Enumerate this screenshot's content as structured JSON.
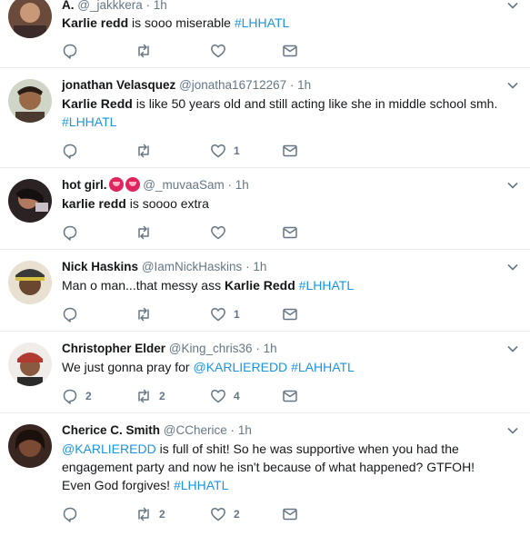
{
  "tweets": [
    {
      "name": "A.",
      "handle": "@_jakkkera",
      "dot": "·",
      "time": "1h",
      "text": [
        {
          "t": "Karlie redd",
          "s": "bold"
        },
        {
          "t": " is sooo miserable ",
          "s": ""
        },
        {
          "t": "#LHHATL",
          "s": "link"
        }
      ],
      "counts": {
        "reply": "",
        "retweet": "",
        "like": ""
      },
      "avatar_color": "#6a4a3a"
    },
    {
      "name": "jonathan Velasquez",
      "handle": "@jonatha16712267",
      "dot": "·",
      "time": "1h",
      "text": [
        {
          "t": "Karlie Redd",
          "s": "bold"
        },
        {
          "t": " is like 50 years old and still acting like she in middle school smh. ",
          "s": ""
        },
        {
          "t": "#LHHATL",
          "s": "link"
        }
      ],
      "counts": {
        "reply": "",
        "retweet": "",
        "like": "1"
      },
      "avatar_color": "#7a5a3e"
    },
    {
      "name": "hot girl.",
      "handle": "@_muvaaSam",
      "dot": "·",
      "time": "1h",
      "text": [
        {
          "t": "karlie redd",
          "s": "bold"
        },
        {
          "t": " is soooo extra",
          "s": ""
        }
      ],
      "counts": {
        "reply": "",
        "retweet": "",
        "like": ""
      },
      "avatar_color": "#2b2224"
    },
    {
      "name": "Nick Haskins",
      "handle": "@IamNickHaskins",
      "dot": "·",
      "time": "1h",
      "text": [
        {
          "t": "Man o man...that messy ass ",
          "s": ""
        },
        {
          "t": "Karlie Redd",
          "s": "bold"
        },
        {
          "t": " ",
          "s": ""
        },
        {
          "t": "#LHHATL",
          "s": "link"
        }
      ],
      "counts": {
        "reply": "",
        "retweet": "",
        "like": "1"
      },
      "avatar_color": "#8a6a4a"
    },
    {
      "name": "Christopher Elder",
      "handle": "@King_chris36",
      "dot": "·",
      "time": "1h",
      "text": [
        {
          "t": "We just gonna pray for ",
          "s": ""
        },
        {
          "t": "@KARLIEREDD",
          "s": "link"
        },
        {
          "t": " ",
          "s": ""
        },
        {
          "t": "#LAHHATL",
          "s": "link"
        }
      ],
      "counts": {
        "reply": "2",
        "retweet": "2",
        "like": "4"
      },
      "avatar_color": "#a04a3a"
    },
    {
      "name": "Cherice C. Smith",
      "handle": "@CCherice",
      "dot": "·",
      "time": "1h",
      "text": [
        {
          "t": "@KARLIEREDD",
          "s": "link"
        },
        {
          "t": " is full of shit! So he was supportive when you had the engagement party and now he isn't because of what happened? GTFOH! Even God forgives!  ",
          "s": ""
        },
        {
          "t": "#LHHATL",
          "s": "link"
        }
      ],
      "counts": {
        "reply": "",
        "retweet": "2",
        "like": "2"
      },
      "avatar_color": "#3a2620"
    }
  ]
}
